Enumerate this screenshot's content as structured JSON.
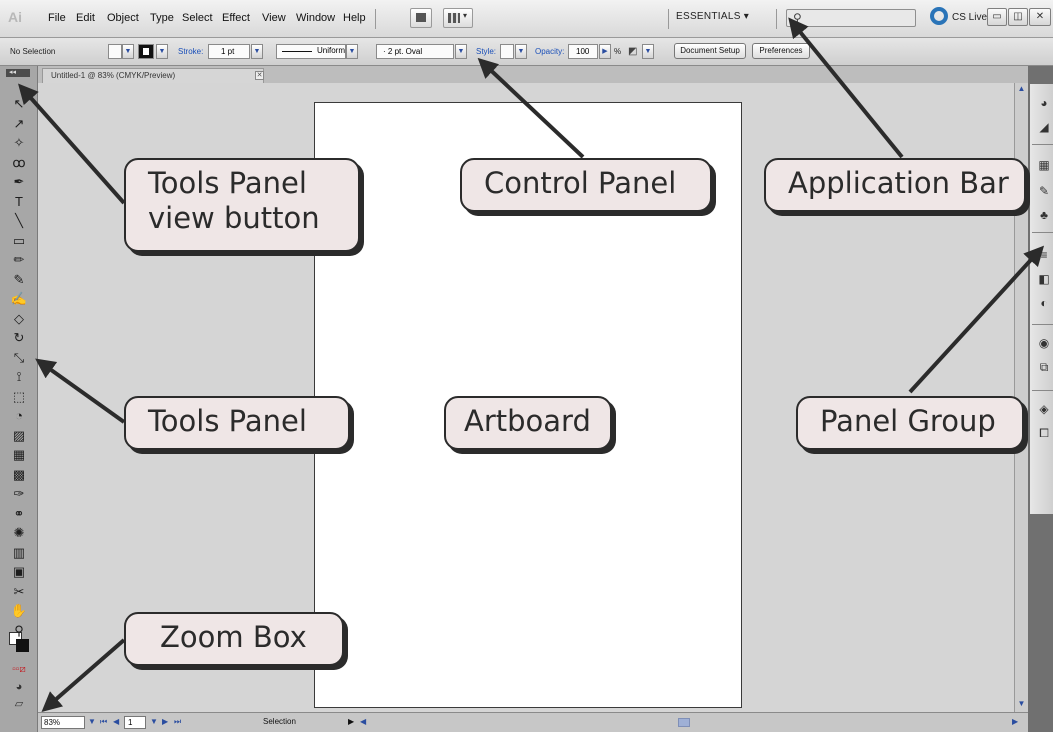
{
  "app_bar": {
    "logo_text": "Ai",
    "menus": [
      "File",
      "Edit",
      "Object",
      "Type",
      "Select",
      "Effect",
      "View",
      "Window",
      "Help"
    ],
    "workspace_label": "ESSENTIALS",
    "cslive_label": "CS Live"
  },
  "control_panel": {
    "selection_label": "No Selection",
    "stroke_label": "Stroke:",
    "stroke_value": "1 pt",
    "profile_label": "Uniform",
    "brush_label": "2 pt. Oval",
    "style_label": "Style:",
    "opacity_label": "Opacity:",
    "opacity_value": "100",
    "opacity_unit": "%",
    "document_setup_label": "Document Setup",
    "preferences_label": "Preferences"
  },
  "document": {
    "tab_title": "Untitled-1 @ 83% (CMYK/Preview)"
  },
  "status_bar": {
    "zoom_value": "83%",
    "page_value": "1",
    "tool_label": "Selection"
  },
  "callouts": {
    "tools_panel_view_button": "Tools Panel view button",
    "tools_panel_view_button_line1": "Tools Panel",
    "tools_panel_view_button_line2": "view button",
    "control_panel": "Control Panel",
    "application_bar": "Application Bar",
    "tools_panel": "Tools Panel",
    "artboard": "Artboard",
    "panel_group": "Panel Group",
    "zoom_box": "Zoom Box"
  },
  "tool_icons": [
    "selection-tool-icon",
    "direct-selection-tool-icon",
    "magic-wand-tool-icon",
    "lasso-tool-icon",
    "pen-tool-icon",
    "type-tool-icon",
    "line-tool-icon",
    "rectangle-tool-icon",
    "paintbrush-tool-icon",
    "pencil-tool-icon",
    "blob-brush-tool-icon",
    "eraser-tool-icon",
    "rotate-tool-icon",
    "scale-tool-icon",
    "width-tool-icon",
    "free-transform-tool-icon",
    "shape-builder-tool-icon",
    "perspective-grid-tool-icon",
    "mesh-tool-icon",
    "gradient-tool-icon",
    "eyedropper-tool-icon",
    "blend-tool-icon",
    "symbol-sprayer-tool-icon",
    "column-graph-tool-icon",
    "artboard-tool-icon",
    "slice-tool-icon",
    "hand-tool-icon",
    "zoom-tool-icon"
  ],
  "colors": {
    "callout_fill": "#efe6e6",
    "callout_border": "#2b2b2b",
    "arrow": "#2b2b2b",
    "cslive_blue": "#2a74b8"
  }
}
